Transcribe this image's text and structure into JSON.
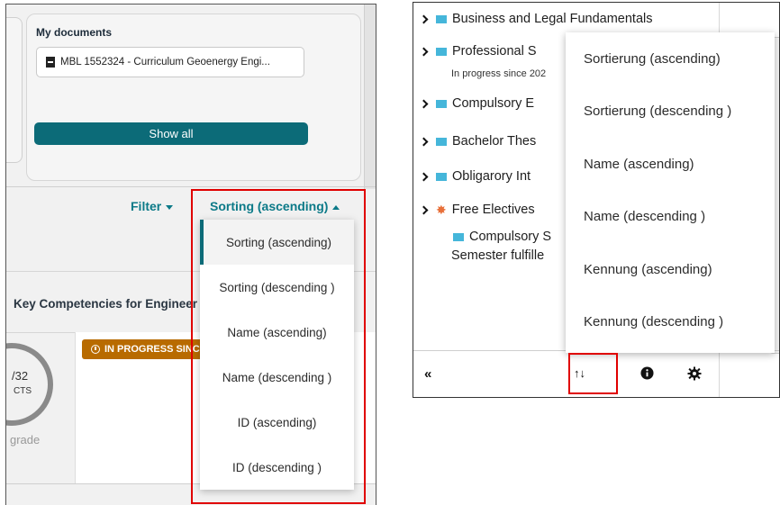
{
  "left": {
    "docs_title": "My documents",
    "doc_item_label": "MBL 1552324 - Curriculum Geoenergy Engi...",
    "show_all_label": "Show all",
    "filter_label": "Filter",
    "sorting_label": "Sorting (ascending)",
    "section_title": "Key Competencies for Engineer",
    "ring_value": "/32",
    "ring_unit": "CTS",
    "grade_label": "grade",
    "badge_label": "IN PROGRESS SINC",
    "sort_options": [
      "Sorting (ascending)",
      "Sorting (descending )",
      "Name (ascending)",
      "Name (descending )",
      "ID (ascending)",
      "ID (descending )"
    ]
  },
  "right": {
    "tree": [
      "Business and Legal Fundamentals",
      "Professional S",
      "Compulsory E",
      "Bachelor Thes",
      "Obligarory Int",
      "Free Electives"
    ],
    "in_progress_note": "In progress since 202",
    "sub_compulsory": "Compulsory S",
    "semester_note": "Semester fulfille",
    "sort_options": [
      "Sortierung (ascending)",
      "Sortierung (descending )",
      "Name (ascending)",
      "Name (descending )",
      "Kennung (ascending)",
      "Kennung (descending )"
    ]
  },
  "colors": {
    "accent": "#0c6b78",
    "link": "#0c7a88",
    "badge": "#b86b00",
    "highlight_box": "#e00000",
    "flag": "#45b6da"
  }
}
